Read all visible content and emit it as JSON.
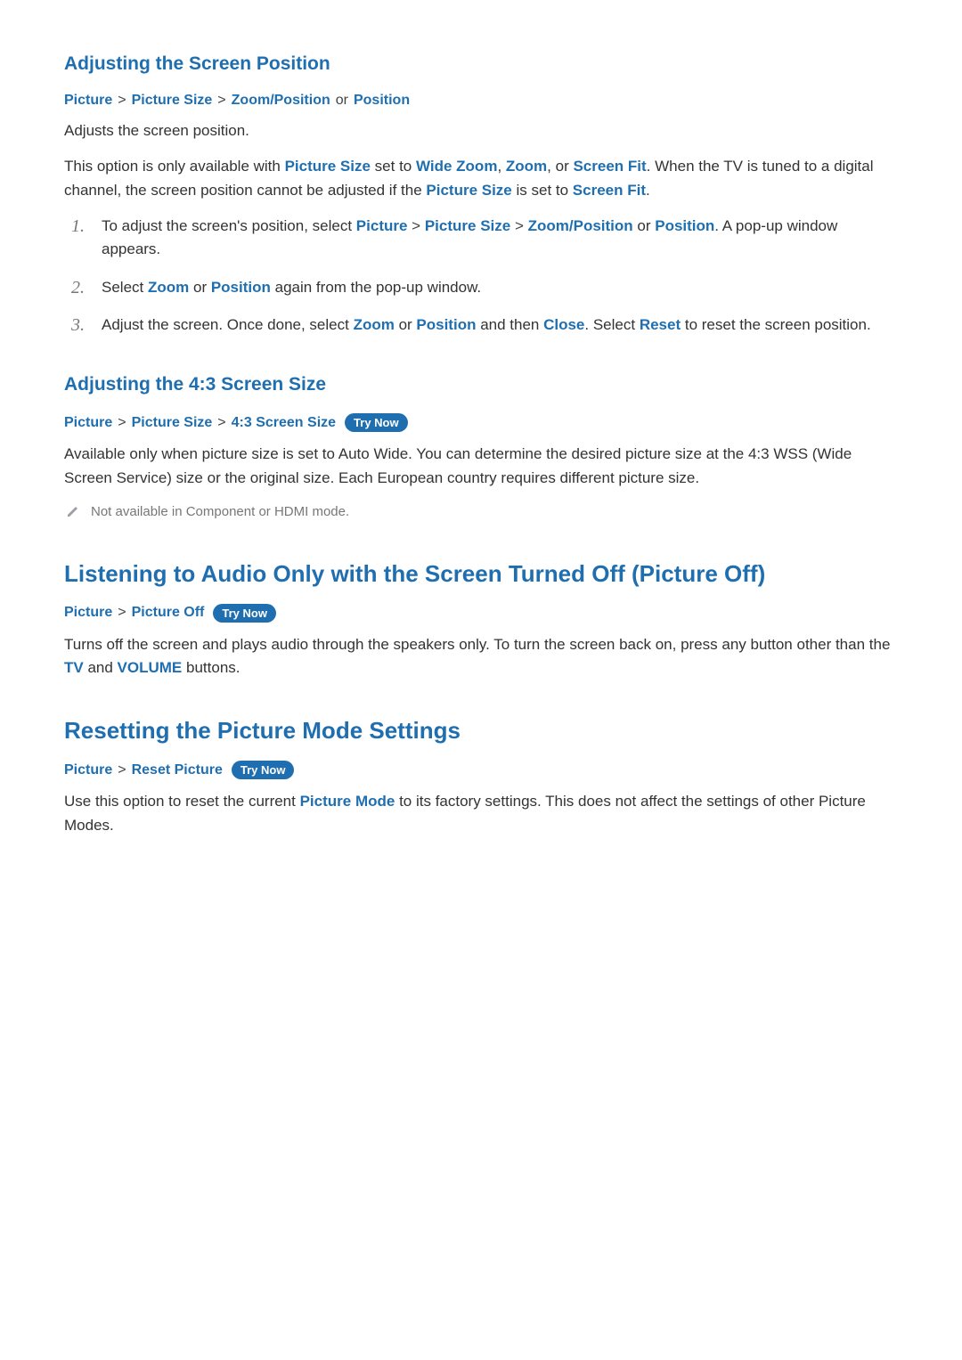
{
  "s1": {
    "heading": "Adjusting the Screen Position",
    "crumbs": [
      "Picture",
      "Picture Size",
      "Zoom/Position"
    ],
    "crumbs_or": "or",
    "crumbs_tail": "Position",
    "p1": "Adjusts the screen position.",
    "p2a": "This option is only available with ",
    "p2_kw1": "Picture Size",
    "p2b": " set to ",
    "p2_kw2": "Wide Zoom",
    "p2c": ", ",
    "p2_kw3": "Zoom",
    "p2d": ", or ",
    "p2_kw4": "Screen Fit",
    "p2e": ". When the TV is tuned to a digital channel, the screen position cannot be adjusted if the ",
    "p2_kw5": "Picture Size",
    "p2f": " is set to ",
    "p2_kw6": "Screen Fit",
    "p2g": ".",
    "li1a": "To adjust the screen's position, select ",
    "li1_kw1": "Picture",
    "li1_kw2": "Picture Size",
    "li1_kw3": "Zoom/Position",
    "li1_or": " or ",
    "li1_kw4": "Position",
    "li1b": ". A pop-up window appears.",
    "li2a": "Select ",
    "li2_kw1": "Zoom",
    "li2_or": " or ",
    "li2_kw2": "Position",
    "li2b": " again from the pop-up window.",
    "li3a": "Adjust the screen. Once done, select ",
    "li3_kw1": "Zoom",
    "li3_or": " or ",
    "li3_kw2": "Position",
    "li3b": " and then ",
    "li3_kw3": "Close",
    "li3c": ". Select ",
    "li3_kw4": "Reset",
    "li3d": " to reset the screen position."
  },
  "s2": {
    "heading": "Adjusting the 4:3 Screen Size",
    "crumbs": [
      "Picture",
      "Picture Size",
      "4:3 Screen Size"
    ],
    "try_now": "Try Now",
    "p1": "Available only when picture size is set to Auto Wide. You can determine the desired picture size at the 4:3 WSS (Wide Screen Service) size or the original size. Each European country requires different picture size.",
    "note": "Not available in Component or HDMI mode."
  },
  "s3": {
    "heading": "Listening to Audio Only with the Screen Turned Off (Picture Off)",
    "crumbs": [
      "Picture",
      "Picture Off"
    ],
    "try_now": "Try Now",
    "p1a": "Turns off the screen and plays audio through the speakers only. To turn the screen back on, press any button other than the ",
    "p1_kw1": "TV",
    "p1b": " and ",
    "p1_kw2": "VOLUME",
    "p1c": " buttons."
  },
  "s4": {
    "heading": "Resetting the Picture Mode Settings",
    "crumbs": [
      "Picture",
      "Reset Picture"
    ],
    "try_now": "Try Now",
    "p1a": "Use this option to reset the current ",
    "p1_kw1": "Picture Mode",
    "p1b": " to its factory settings. This does not affect the settings of other Picture Modes."
  },
  "caret": ">"
}
